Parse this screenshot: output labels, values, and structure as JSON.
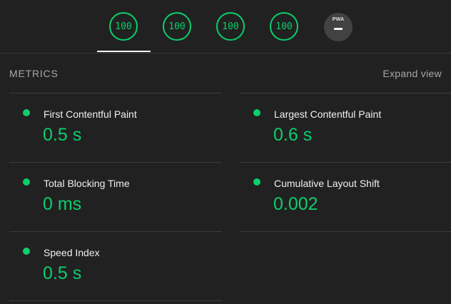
{
  "gauges": [
    {
      "score": "100"
    },
    {
      "score": "100"
    },
    {
      "score": "100"
    },
    {
      "score": "100"
    }
  ],
  "pwa": {
    "label": "PWA"
  },
  "metrics": {
    "title": "METRICS",
    "expand_label": "Expand view",
    "status_color": "#0cce6b",
    "items": [
      {
        "label": "First Contentful Paint",
        "value": "0.5 s",
        "status": "pass"
      },
      {
        "label": "Largest Contentful Paint",
        "value": "0.6 s",
        "status": "pass"
      },
      {
        "label": "Total Blocking Time",
        "value": "0 ms",
        "status": "pass"
      },
      {
        "label": "Cumulative Layout Shift",
        "value": "0.002",
        "status": "pass"
      },
      {
        "label": "Speed Index",
        "value": "0.5 s",
        "status": "pass"
      }
    ]
  }
}
